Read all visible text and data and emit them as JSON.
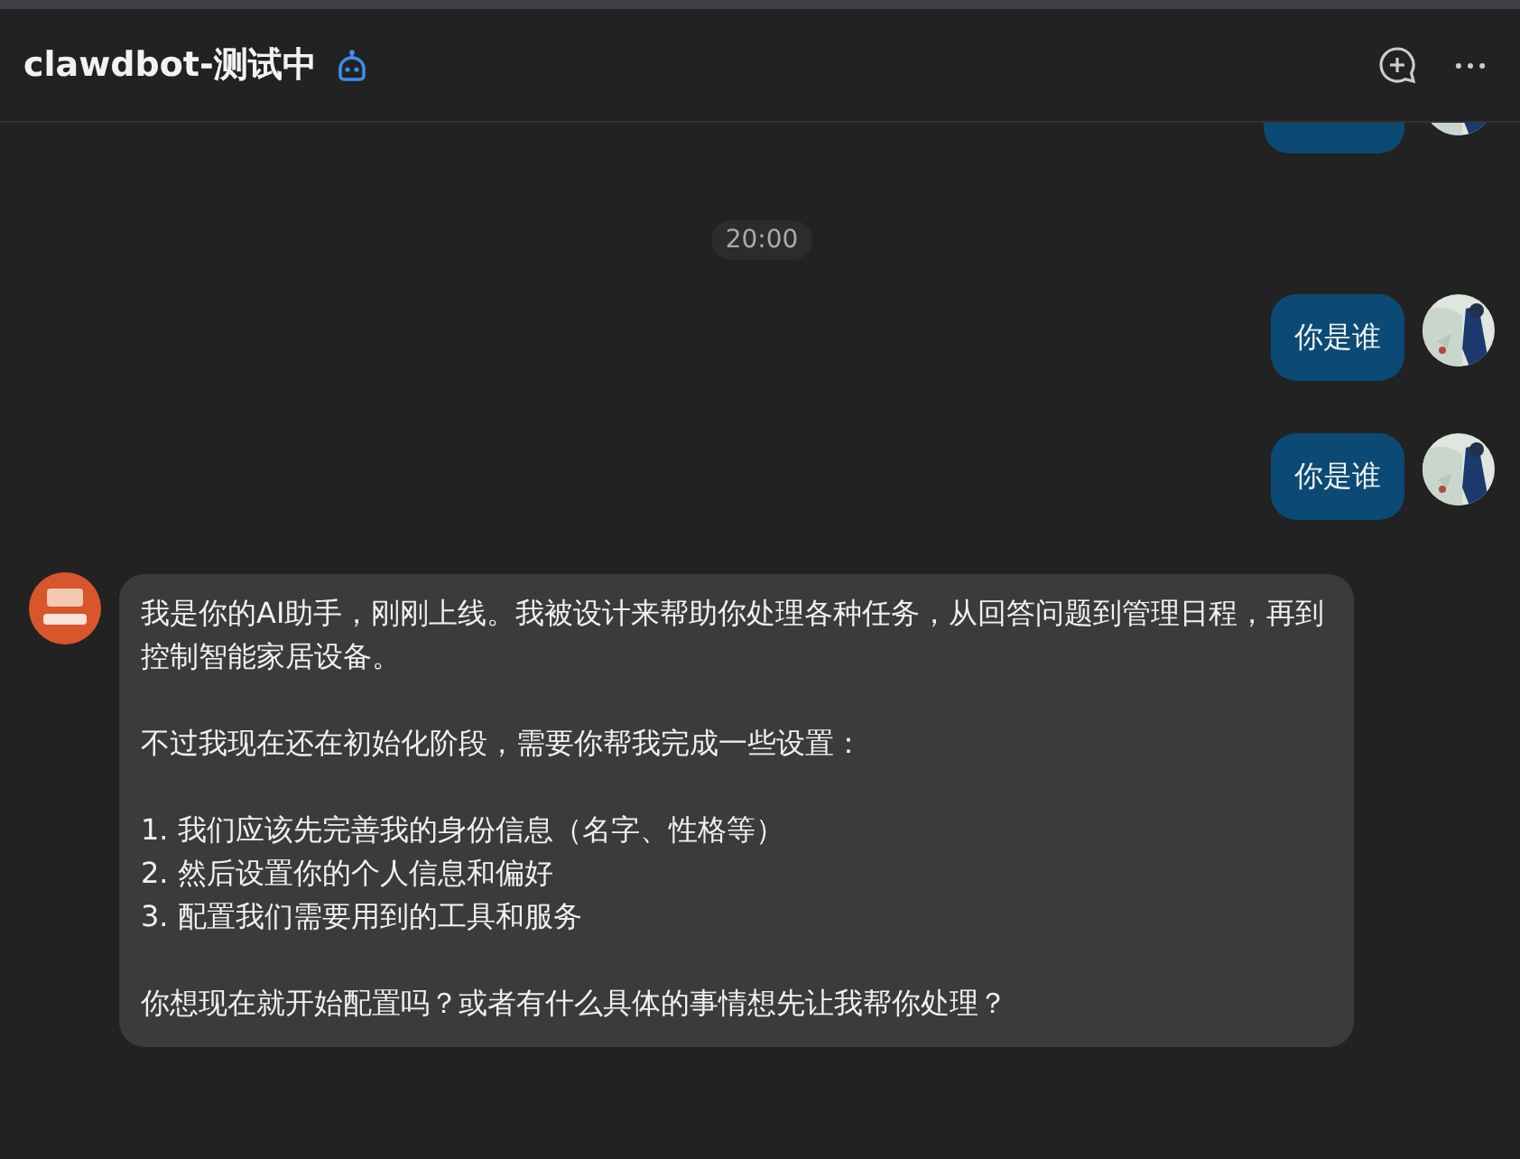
{
  "header": {
    "title": "clawdbot-测试中"
  },
  "messages": [
    {
      "kind": "user_cut"
    },
    {
      "kind": "time",
      "text": "20:00"
    },
    {
      "kind": "user_text",
      "paragraphs": [
        "你是谁"
      ]
    },
    {
      "kind": "user_text",
      "paragraphs": [
        "你是谁"
      ]
    },
    {
      "kind": "bot_text",
      "paragraphs": [
        "我是你的AI助手，刚刚上线。我被设计来帮助你处理各种任务，从回答问题到管理日程，再到控制智能家居设备。",
        "不过我现在还在初始化阶段，需要你帮我完成一些设置：",
        "1. 我们应该先完善我的身份信息（名字、性格等）\n2. 然后设置你的个人信息和偏好\n3. 配置我们需要用到的工具和服务",
        "你想现在就开始配置吗？或者有什么具体的事情想先让我帮你处理？"
      ]
    }
  ]
}
